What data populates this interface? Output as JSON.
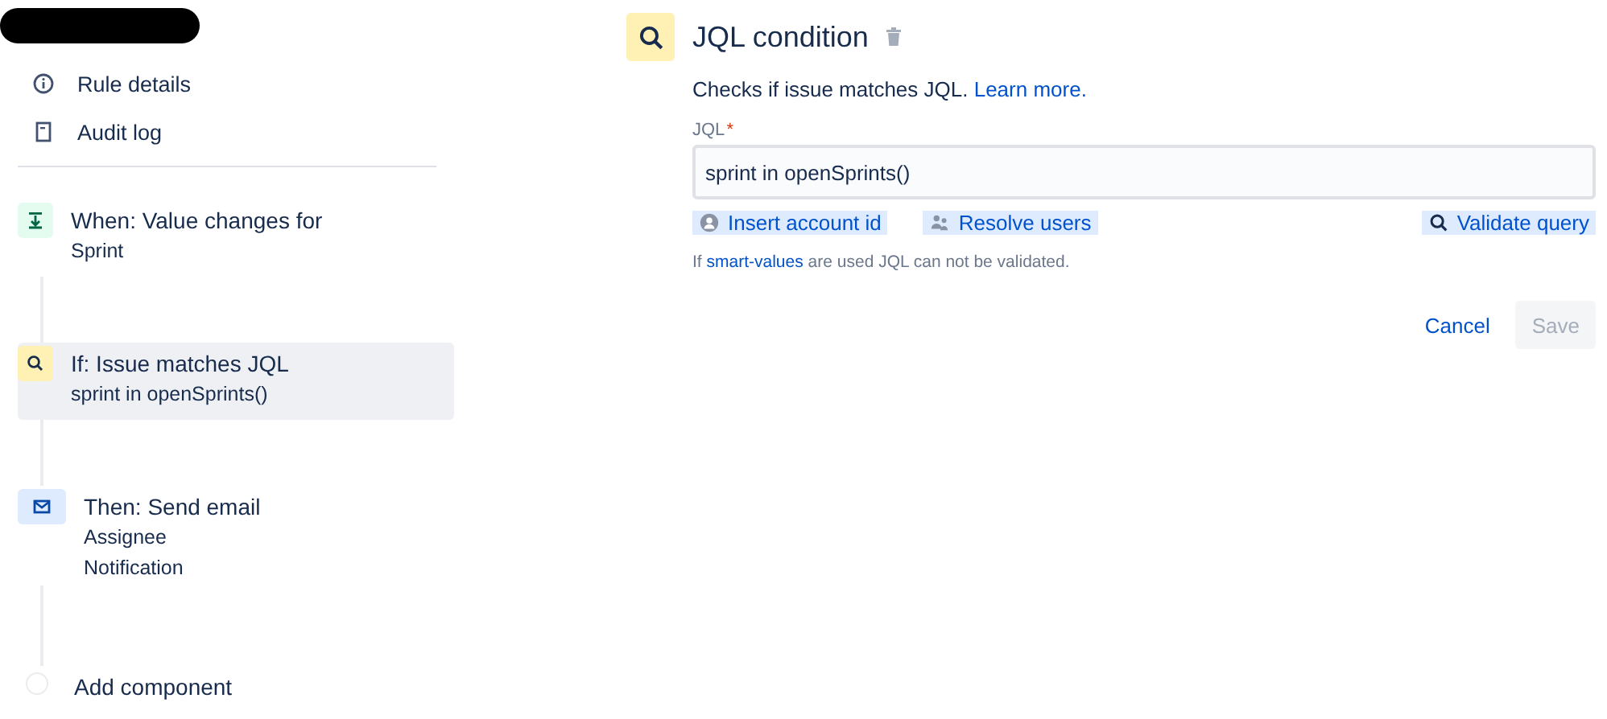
{
  "nav": [
    {
      "kind": "info",
      "label": "Rule details"
    },
    {
      "kind": "log",
      "label": "Audit log"
    }
  ],
  "steps": [
    {
      "kind": "trigger",
      "title": "When: Value changes for",
      "lines": [
        "Sprint"
      ],
      "selected": false
    },
    {
      "kind": "condition",
      "title": "If: Issue matches JQL",
      "lines": [
        "sprint in openSprints()"
      ],
      "selected": true
    },
    {
      "kind": "action",
      "title": "Then: Send email",
      "lines": [
        "Assignee",
        "Notification"
      ],
      "selected": false
    },
    {
      "kind": "add",
      "title": "Add component",
      "selected": false
    }
  ],
  "panel": {
    "title": "JQL condition",
    "description": {
      "text": "Checks if issue matches JQL.",
      "link": "Learn more."
    },
    "field": {
      "label": "JQL",
      "required_mark": "*",
      "value": "sprint in openSprints()"
    },
    "actions": [
      {
        "kind": "account",
        "label": "Insert account id"
      },
      {
        "kind": "users",
        "label": "Resolve users"
      },
      {
        "kind": "search",
        "label": "Validate query"
      }
    ],
    "hint": {
      "before": "If",
      "link": "smart-values",
      "after": "are used JQL can not be validated."
    },
    "buttons": [
      {
        "kind": "link",
        "label": "Cancel",
        "disabled": false
      },
      {
        "kind": "primary",
        "label": "Save",
        "disabled": true
      }
    ]
  }
}
